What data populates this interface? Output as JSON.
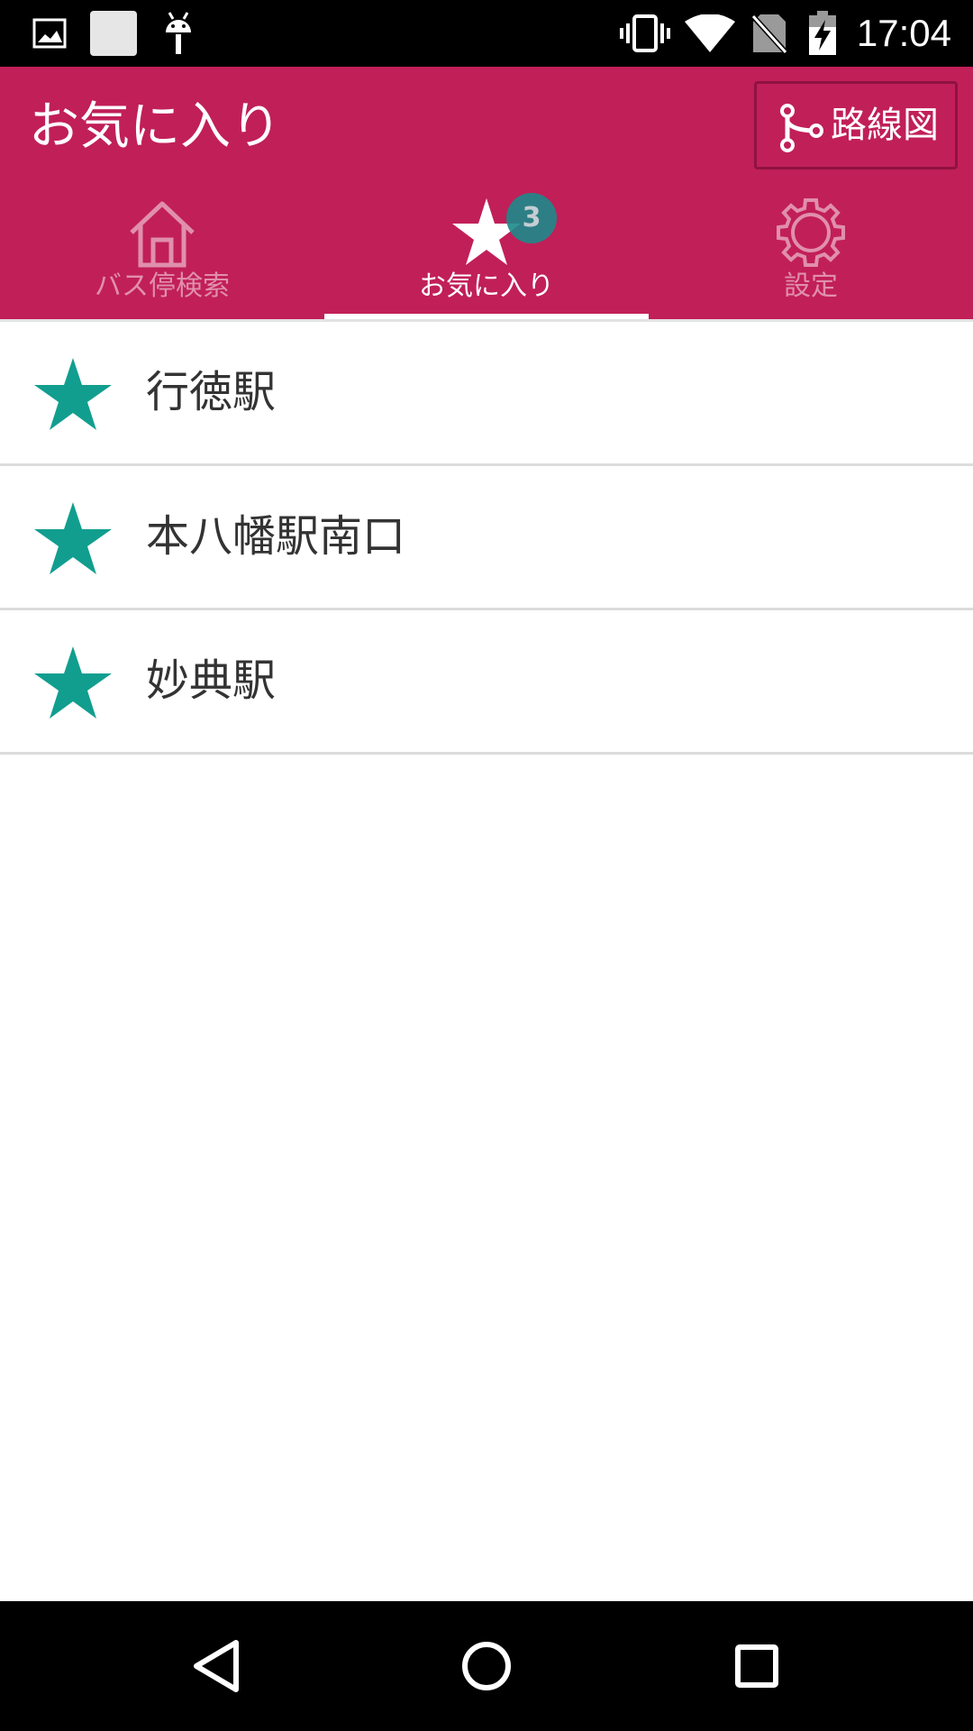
{
  "status_bar": {
    "time": "17:04",
    "left_icons": [
      "gallery-icon",
      "notification-square-icon",
      "android-debug-icon"
    ],
    "right_icons": [
      "vibrate-icon",
      "wifi-icon",
      "no-sim-icon",
      "battery-charging-icon"
    ]
  },
  "header": {
    "title": "お気に入り",
    "route_map_button": {
      "icon": "route-map-icon",
      "label": "路線図"
    }
  },
  "tabs": [
    {
      "label": "バス停検索",
      "icon": "home-icon",
      "active": false
    },
    {
      "label": "お気に入り",
      "icon": "star-icon",
      "active": true,
      "badge": "3"
    },
    {
      "label": "設定",
      "icon": "gear-icon",
      "active": false
    }
  ],
  "favorites": [
    {
      "name": "行徳駅",
      "icon": "star-icon"
    },
    {
      "name": "本八幡駅南口",
      "icon": "star-icon"
    },
    {
      "name": "妙典駅",
      "icon": "star-icon"
    }
  ],
  "nav_bar": {
    "buttons": [
      "back-icon",
      "home-circle-icon",
      "recents-icon"
    ]
  },
  "colors": {
    "app_bar": "#c11f58",
    "accent": "#119e8f",
    "badge": "#1d8a8a",
    "status_bar": "#000000",
    "divider": "#dcdcdc",
    "text_primary": "#333333"
  }
}
